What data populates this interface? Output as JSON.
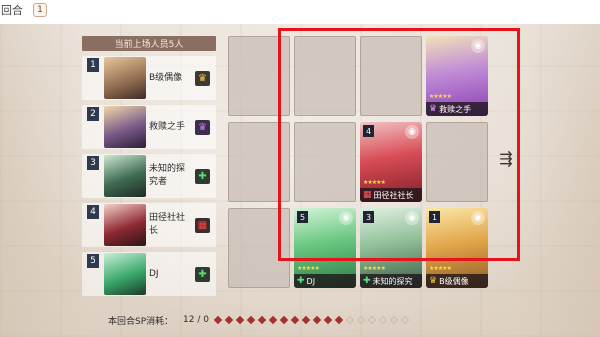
{
  "round": {
    "label": "回合",
    "value": "1"
  },
  "roster": {
    "header": "当前上场人员5人",
    "items": [
      {
        "index": "1",
        "name": "B级偶像",
        "role_glyph": "♛",
        "role_icon": "gold-crown-icon",
        "role_class": "role-gold",
        "portrait_bg": "linear-gradient(160deg,#e9c79a,#8e6a4f 60%,#3e2b26)"
      },
      {
        "index": "2",
        "name": "救赎之手",
        "role_glyph": "♛",
        "role_icon": "purple-crown-icon",
        "role_class": "role-purple",
        "portrait_bg": "linear-gradient(160deg,#f0d9a8,#7a5a8a 55%,#2a1f33)"
      },
      {
        "index": "3",
        "name": "未知的探究者",
        "role_glyph": "✚",
        "role_icon": "green-cross-icon",
        "role_class": "role-green",
        "portrait_bg": "linear-gradient(160deg,#cde7d1,#3f6b52 55%,#1d2b25)"
      },
      {
        "index": "4",
        "name": "田径社社长",
        "role_glyph": "▦",
        "role_icon": "red-grid-icon",
        "role_class": "role-red",
        "portrait_bg": "linear-gradient(160deg,#f3d1c9,#8f2a33 55%,#2a1416)"
      },
      {
        "index": "5",
        "name": "DJ",
        "role_glyph": "✚",
        "role_icon": "green-cross-icon",
        "role_class": "role-green",
        "portrait_bg": "linear-gradient(160deg,#c8f0da,#3aa86b 55%,#1a3a2a)"
      }
    ]
  },
  "board_cards": [
    {
      "id": "card-top-right",
      "num": "",
      "name": "救赎之手",
      "cost": "",
      "icon": "purple-crown-icon",
      "glyph": "♛",
      "bg": "linear-gradient(170deg,#f2e1b8 0%,#c08bd6 45%,#8a3fb3 100%)"
    },
    {
      "id": "card-mid",
      "num": "4",
      "name": "田径社社长",
      "cost": "",
      "icon": "red-grid-icon",
      "glyph": "▦",
      "bg": "linear-gradient(170deg,#f0c2c2 0%,#d84b55 45%,#7d1f28 100%)"
    },
    {
      "id": "card-bottom-left",
      "num": "5",
      "name": "DJ",
      "cost": "",
      "icon": "green-cross-icon",
      "glyph": "✚",
      "bg": "linear-gradient(170deg,#d3f3d8 0%,#67c67f 45%,#2d7a47 100%)"
    },
    {
      "id": "card-bottom-mid",
      "num": "3",
      "name": "未知的探究",
      "cost": "",
      "icon": "green-cross-icon",
      "glyph": "✚",
      "bg": "linear-gradient(170deg,#dff0e2 0%,#8fbf97 45%,#3c5a44 100%)"
    },
    {
      "id": "card-bottom-right",
      "num": "1",
      "name": "B级偶像",
      "cost": "",
      "icon": "gold-crown-icon",
      "glyph": "♛",
      "bg": "linear-gradient(170deg,#fbe6a8 0%,#e2a64a 45%,#8f5a24 100%)"
    }
  ],
  "card_stars": "★★★★★",
  "sp": {
    "label": "本回合SP消耗：",
    "value": "12 / 0",
    "filled": 12,
    "total": 18
  },
  "colors": {
    "highlight": "#e5141a",
    "pip_full": "#a3312f",
    "roster_header": "#8a6e61"
  },
  "nav_icon": "move-arrow-icon"
}
